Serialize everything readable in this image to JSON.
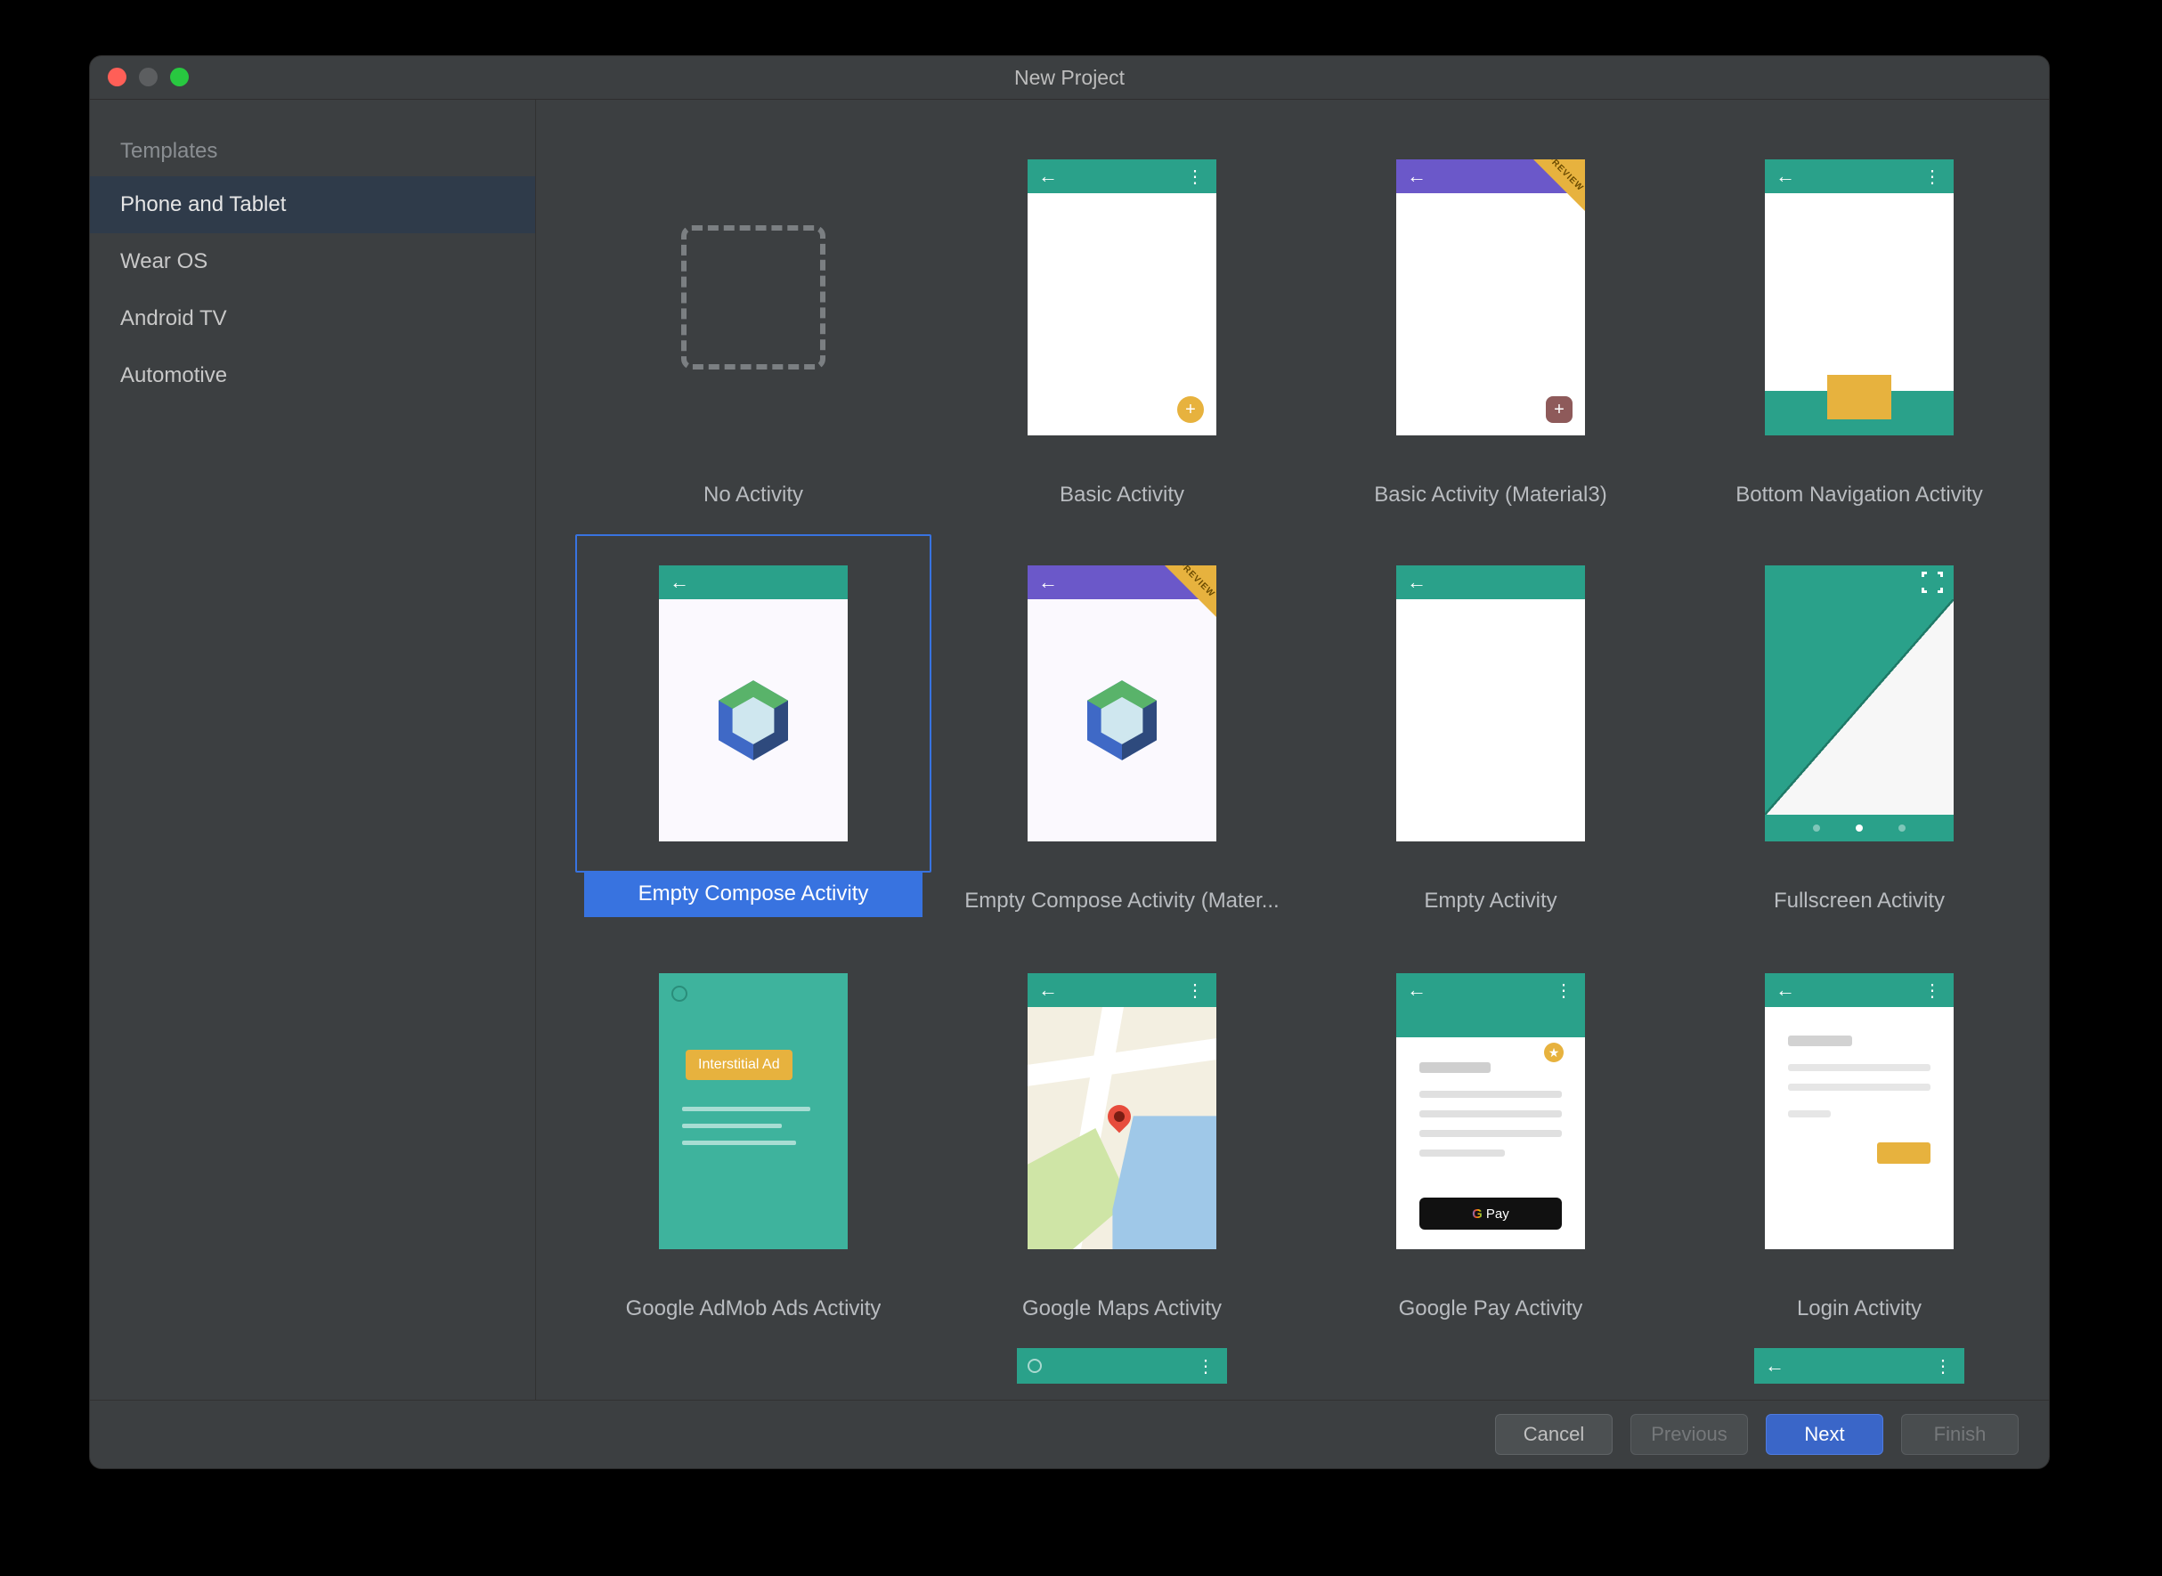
{
  "window": {
    "title": "New Project"
  },
  "sidebar": {
    "header": "Templates",
    "items": [
      {
        "label": "Phone and Tablet",
        "selected": true
      },
      {
        "label": "Wear OS"
      },
      {
        "label": "Android TV"
      },
      {
        "label": "Automotive"
      }
    ]
  },
  "templates": [
    {
      "id": "no-activity",
      "label": "No Activity"
    },
    {
      "id": "basic-activity",
      "label": "Basic Activity"
    },
    {
      "id": "basic-activity-m3",
      "label": "Basic Activity (Material3)",
      "preview_badge": "PREVIEW"
    },
    {
      "id": "bottom-nav",
      "label": "Bottom Navigation Activity"
    },
    {
      "id": "empty-compose",
      "label": "Empty Compose Activity",
      "selected": true
    },
    {
      "id": "empty-compose-m3",
      "label": "Empty Compose Activity (Mater...",
      "preview_badge": "PREVIEW"
    },
    {
      "id": "empty-activity",
      "label": "Empty Activity"
    },
    {
      "id": "fullscreen",
      "label": "Fullscreen Activity"
    },
    {
      "id": "admob",
      "label": "Google AdMob Ads Activity",
      "ad_text": "Interstitial Ad"
    },
    {
      "id": "maps",
      "label": "Google Maps Activity"
    },
    {
      "id": "gpay",
      "label": "Google Pay Activity",
      "pay_text": "Pay",
      "pay_g": "G "
    },
    {
      "id": "login",
      "label": "Login Activity"
    }
  ],
  "footer": {
    "cancel": "Cancel",
    "previous": "Previous",
    "next": "Next",
    "finish": "Finish"
  }
}
